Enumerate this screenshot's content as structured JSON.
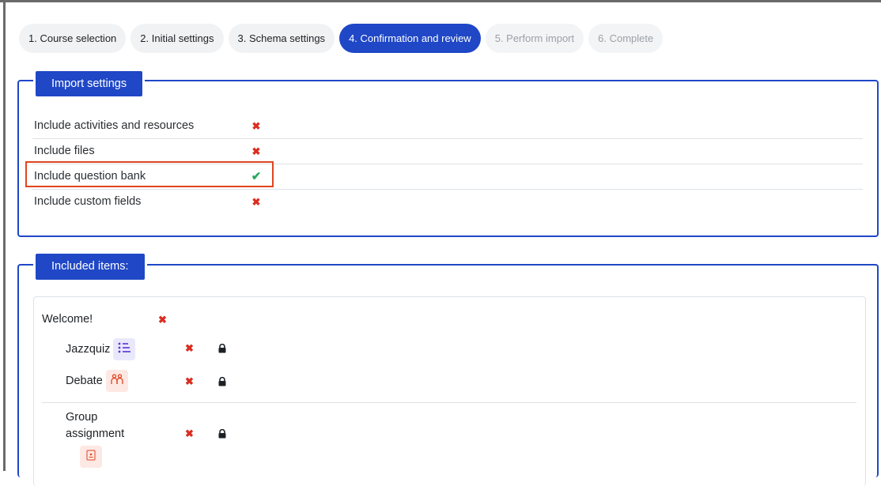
{
  "steps": [
    {
      "label": "1. Course selection",
      "state": "done"
    },
    {
      "label": "2. Initial settings",
      "state": "done"
    },
    {
      "label": "3. Schema settings",
      "state": "done"
    },
    {
      "label": "4. Confirmation and review",
      "state": "active"
    },
    {
      "label": "5. Perform import",
      "state": "disabled"
    },
    {
      "label": "6. Complete",
      "state": "disabled"
    }
  ],
  "import_settings": {
    "legend": "Import settings",
    "rows": [
      {
        "label": "Include activities and resources",
        "status": "✖",
        "enabled": false
      },
      {
        "label": "Include files",
        "status": "✖",
        "enabled": false
      },
      {
        "label": "Include question bank",
        "status": "✔",
        "enabled": true,
        "highlighted": true
      },
      {
        "label": "Include custom fields",
        "status": "✖",
        "enabled": false
      }
    ]
  },
  "included_items": {
    "legend": "Included items:",
    "section": {
      "title": "Welcome!",
      "status": "✖"
    },
    "activities": [
      {
        "name": "Jazzquiz",
        "icon": "list-icon",
        "status": "✖",
        "locked": true
      },
      {
        "name": "Debate",
        "icon": "people-icon",
        "status": "✖",
        "locked": true
      },
      {
        "name_line1": "Group",
        "name_line2": "assignment",
        "icon": "assignment-icon",
        "status": "✖",
        "locked": true
      }
    ]
  },
  "colors": {
    "primary": "#1f47c6",
    "error": "#d92d20",
    "success": "#2aa860",
    "highlight": "#e0451f"
  }
}
